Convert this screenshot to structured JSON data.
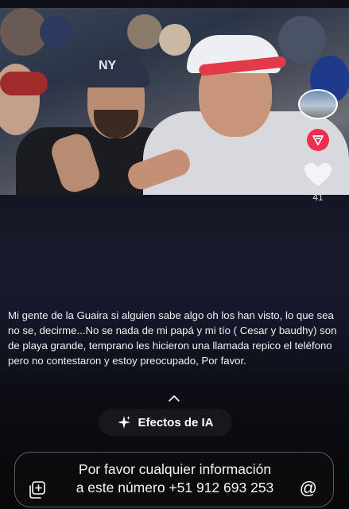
{
  "post": {
    "like_count": "41",
    "caption": "Mi gente de la Guaira si alguien sabe algo oh los han visto, lo que sea no se, decirme...No se nada de mi papá y mi tío ( Cesar y baudhy) son de playa grande, temprano les hicieron una llamada repico el teléfono pero no contestaron y estoy preocupado, Por favor."
  },
  "ai_effects": {
    "label": "Efectos de IA"
  },
  "reply": {
    "line1": "Por favor cualquier información",
    "line2": "a este número +51 912 693 253"
  },
  "icons": {
    "cap_logo": "NY",
    "mention": "@"
  },
  "colors": {
    "accent_red": "#ee2d4f",
    "background": "#0a0a0d"
  }
}
